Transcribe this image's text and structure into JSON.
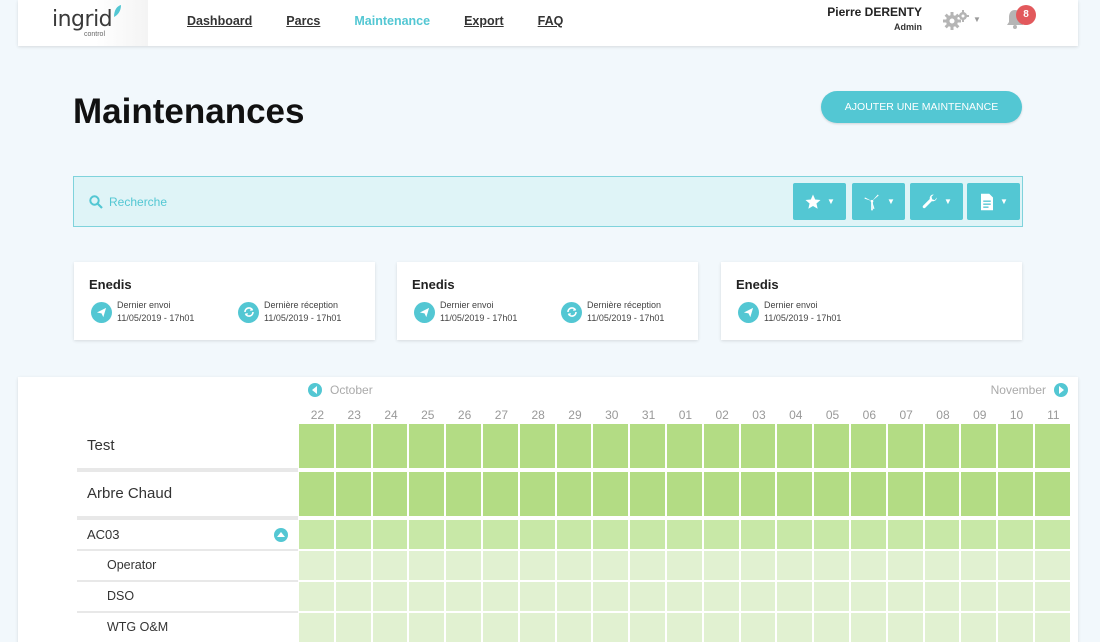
{
  "header": {
    "logo_text": "ingrid",
    "logo_sub": "control",
    "nav": [
      {
        "label": "Dashboard",
        "active": false
      },
      {
        "label": "Parcs",
        "active": false
      },
      {
        "label": "Maintenance",
        "active": true
      },
      {
        "label": "Export",
        "active": false
      },
      {
        "label": "FAQ",
        "active": false
      }
    ],
    "user_name": "Pierre DERENTY",
    "user_role": "Admin",
    "notification_count": "8"
  },
  "page": {
    "title": "Maintenances",
    "add_button": "AJOUTER UNE MAINTENANCE"
  },
  "search": {
    "placeholder": "Recherche",
    "filters": [
      "star-icon",
      "wind-turbine-icon",
      "wrench-icon",
      "document-icon"
    ]
  },
  "cards": [
    {
      "title": "Enedis",
      "stats": [
        {
          "icon": "send-icon",
          "label": "Dernier envoi",
          "value": "11/05/2019 - 17h01"
        },
        {
          "icon": "sync-icon",
          "label": "Dernière réception",
          "value": "11/05/2019 - 17h01"
        }
      ]
    },
    {
      "title": "Enedis",
      "stats": [
        {
          "icon": "send-icon",
          "label": "Dernier envoi",
          "value": "11/05/2019 - 17h01"
        },
        {
          "icon": "sync-icon",
          "label": "Dernière réception",
          "value": "11/05/2019 - 17h01"
        }
      ]
    },
    {
      "title": "Enedis",
      "stats": [
        {
          "icon": "send-icon",
          "label": "Dernier envoi",
          "value": "11/05/2019 - 17h01"
        }
      ]
    }
  ],
  "calendar": {
    "month_prev": "October",
    "month_next": "November",
    "days": [
      "22",
      "23",
      "24",
      "25",
      "26",
      "27",
      "28",
      "29",
      "30",
      "31",
      "01",
      "02",
      "03",
      "04",
      "05",
      "06",
      "07",
      "08",
      "09",
      "10",
      "11"
    ],
    "rows": [
      {
        "label": "Test",
        "level": 0,
        "color": "#b3dc84"
      },
      {
        "label": "Arbre Chaud",
        "level": 0,
        "color": "#b3dc84"
      },
      {
        "label": "AC03",
        "level": 1,
        "color": "#c8e8a7",
        "collapsible": true
      },
      {
        "label": "Operator",
        "level": 2,
        "color": "#e1f1d1"
      },
      {
        "label": "DSO",
        "level": 2,
        "color": "#e1f1d1"
      },
      {
        "label": "WTG O&M",
        "level": 2,
        "color": "#e1f1d1"
      }
    ]
  },
  "colors": {
    "accent": "#53c7d3",
    "badge": "#e2595c"
  }
}
